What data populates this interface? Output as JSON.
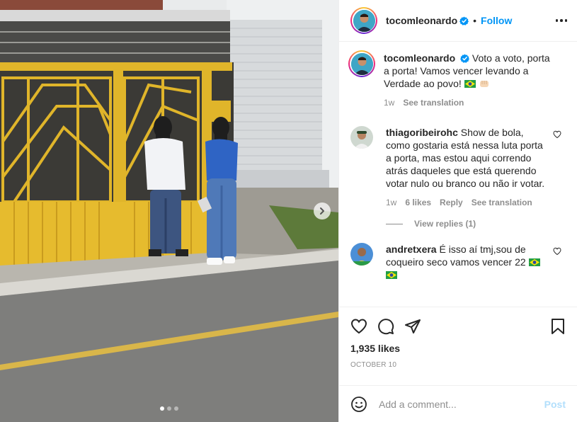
{
  "header": {
    "username": "tocomleonardo",
    "separator": "•",
    "follow_label": "Follow",
    "more_icon": "more-horizontal-icon"
  },
  "caption": {
    "username": "tocomleonardo",
    "text": "Voto a voto, porta a porta! Vamos vencer levando a Verdade ao povo!",
    "time": "1w",
    "see_translation": "See translation"
  },
  "comments": [
    {
      "username": "thiagoribeirohc",
      "text": "Show de bola, como gostaria está nessa luta porta a porta, mas estou aqui correndo atrás daqueles que está querendo votar nulo ou branco ou não ir votar.",
      "time": "1w",
      "likes": "6 likes",
      "reply": "Reply",
      "see_translation": "See translation",
      "view_replies": "View replies (1)"
    },
    {
      "username": "andretxera",
      "text": "É isso aí tmj,sou de coqueiro seco vamos vencer 22"
    }
  ],
  "actions": {
    "likes": "1,935 likes",
    "date": "October 10"
  },
  "comment_box": {
    "placeholder": "Add a comment...",
    "post_label": "Post"
  },
  "colors": {
    "accent": "#0095f6",
    "post_disabled": "#b2dffc",
    "muted": "#8e8e8e"
  },
  "media": {
    "carousel_index": 1,
    "carousel_count": 3
  }
}
